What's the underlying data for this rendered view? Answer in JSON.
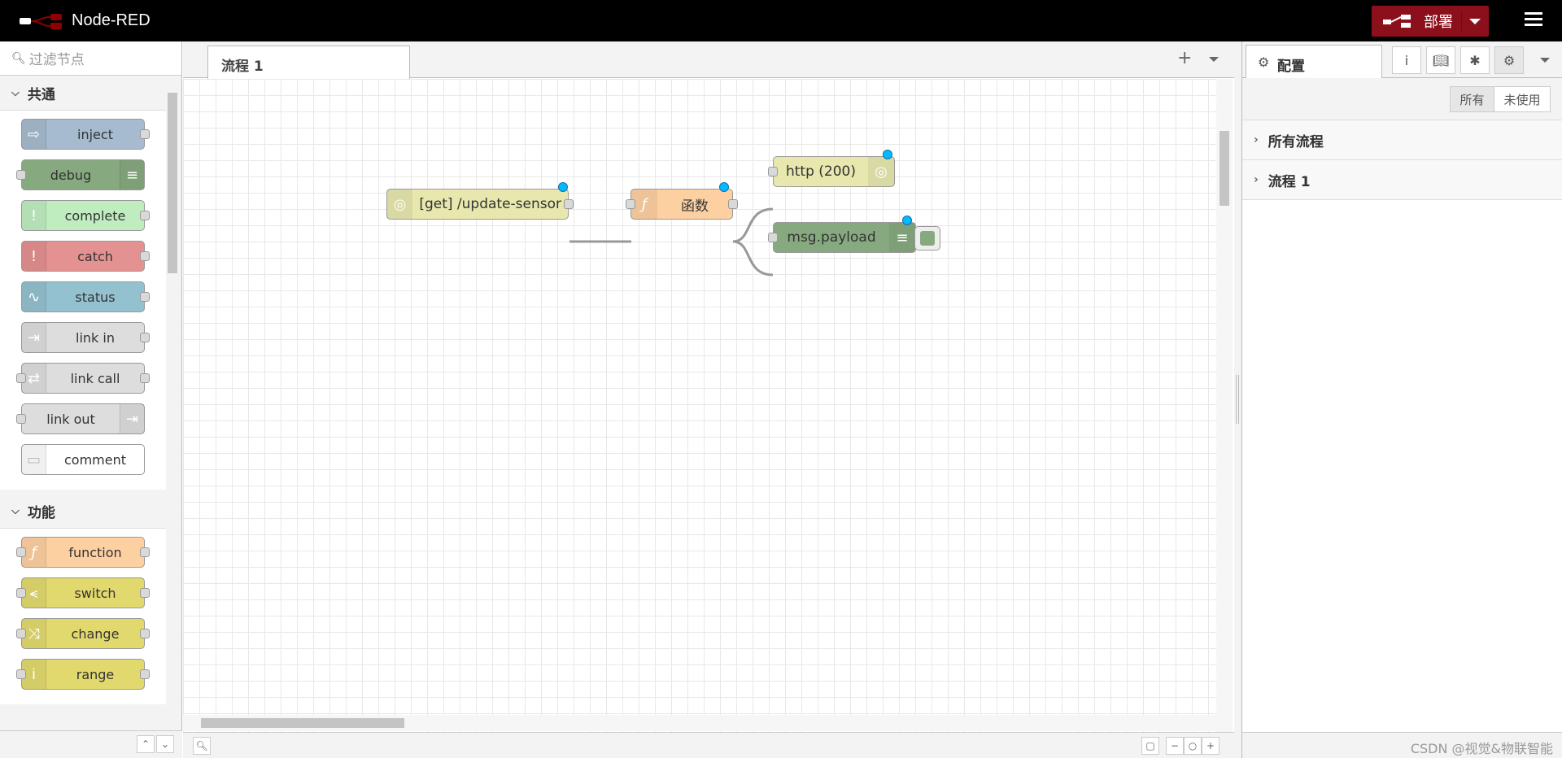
{
  "header": {
    "app_title": "Node-RED",
    "deploy_label": "部署"
  },
  "palette": {
    "search_placeholder": "过滤节点",
    "categories": [
      {
        "label": "共通",
        "nodes": [
          "inject",
          "debug",
          "complete",
          "catch",
          "status",
          "link in",
          "link call",
          "link out",
          "comment"
        ]
      },
      {
        "label": "功能",
        "nodes": [
          "function",
          "switch",
          "change",
          "range"
        ]
      }
    ]
  },
  "workspace": {
    "tab_label": "流程 1",
    "nodes": {
      "http_in": "[get] /update-sensor",
      "function": "函数",
      "http_response": "http (200)",
      "debug": "msg.payload"
    }
  },
  "sidebar": {
    "tab_label": "配置",
    "filter_all": "所有",
    "filter_unused": "未使用",
    "rows": [
      "所有流程",
      "流程 1"
    ]
  },
  "footer": {
    "watermark": "CSDN @视觉&物联智能"
  },
  "colors": {
    "header_bg": "#000000",
    "deploy_bg": "#8c101c",
    "inject": "#a6bbcf",
    "debug": "#87a980",
    "complete": "#c0edc0",
    "catch": "#e49191",
    "status": "#94c1d0",
    "link": "#dddddd",
    "comment": "#ffffff",
    "function": "#fdd0a2",
    "switch": "#e2d96e",
    "change": "#e2d96e",
    "range": "#e2d96e",
    "http": "#e7e7ae",
    "changed_badge": "#00bcff"
  }
}
